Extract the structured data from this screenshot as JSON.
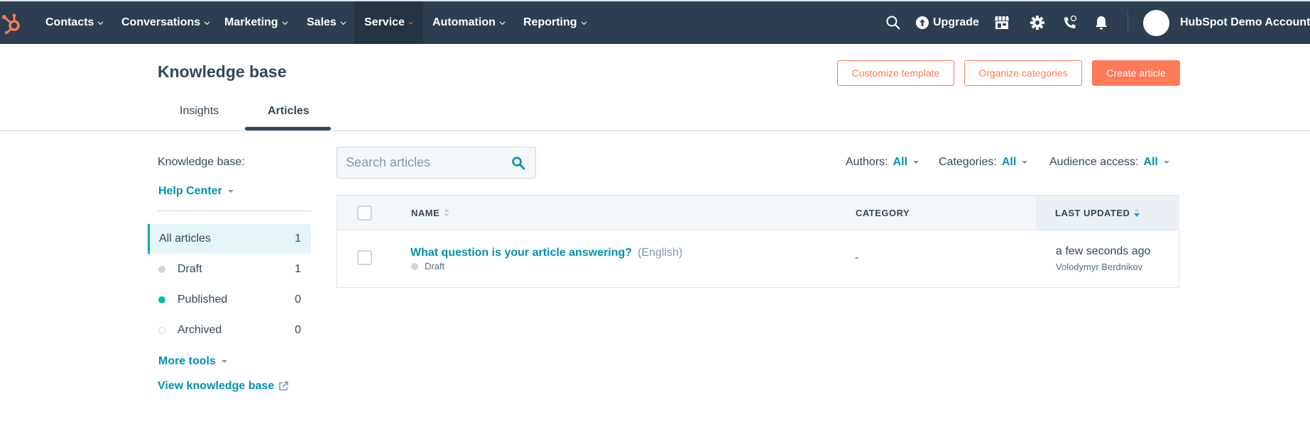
{
  "navbar": {
    "items": [
      {
        "label": "Contacts"
      },
      {
        "label": "Conversations"
      },
      {
        "label": "Marketing"
      },
      {
        "label": "Sales"
      },
      {
        "label": "Service",
        "active": true
      },
      {
        "label": "Automation"
      },
      {
        "label": "Reporting"
      }
    ],
    "upgrade_label": "Upgrade",
    "account_name": "HubSpot Demo Account",
    "icons": [
      "hubspot-logo",
      "search-icon",
      "upgrade-arrow-icon",
      "marketplace-icon",
      "settings-gear-icon",
      "calling-icon",
      "notifications-bell-icon"
    ]
  },
  "header": {
    "title": "Knowledge base",
    "buttons": {
      "customize_template": "Customize template",
      "organize_categories": "Organize categories",
      "create_article": "Create article"
    },
    "tabs": [
      {
        "label": "Insights",
        "active": false
      },
      {
        "label": "Articles",
        "active": true
      }
    ]
  },
  "sidebar": {
    "kb_label": "Knowledge base:",
    "kb_selected": "Help Center",
    "items": [
      {
        "label": "All articles",
        "count": "1",
        "active": true
      },
      {
        "label": "Draft",
        "count": "1",
        "status": "draft"
      },
      {
        "label": "Published",
        "count": "0",
        "status": "published"
      },
      {
        "label": "Archived",
        "count": "0",
        "status": "archived"
      }
    ],
    "more_tools": "More tools",
    "view_kb": "View knowledge base"
  },
  "search": {
    "placeholder": "Search articles",
    "value": ""
  },
  "filters": [
    {
      "label": "Authors:",
      "value": "All"
    },
    {
      "label": "Categories:",
      "value": "All"
    },
    {
      "label": "Audience access:",
      "value": "All"
    }
  ],
  "table": {
    "columns": {
      "name": "NAME",
      "category": "CATEGORY",
      "last_updated": "LAST UPDATED"
    },
    "sorted_by": "last_updated",
    "rows": [
      {
        "title": "What question is your article answering?",
        "language": "(English)",
        "status": "Draft",
        "category": "-",
        "last_updated": "a few seconds ago",
        "author": "Volodymyr Berdnikov"
      }
    ]
  },
  "colors": {
    "nav_bg": "#2d3e50",
    "accent_orange": "#ff7a59",
    "link_teal": "#0091ae",
    "published_green": "#00bda5"
  }
}
